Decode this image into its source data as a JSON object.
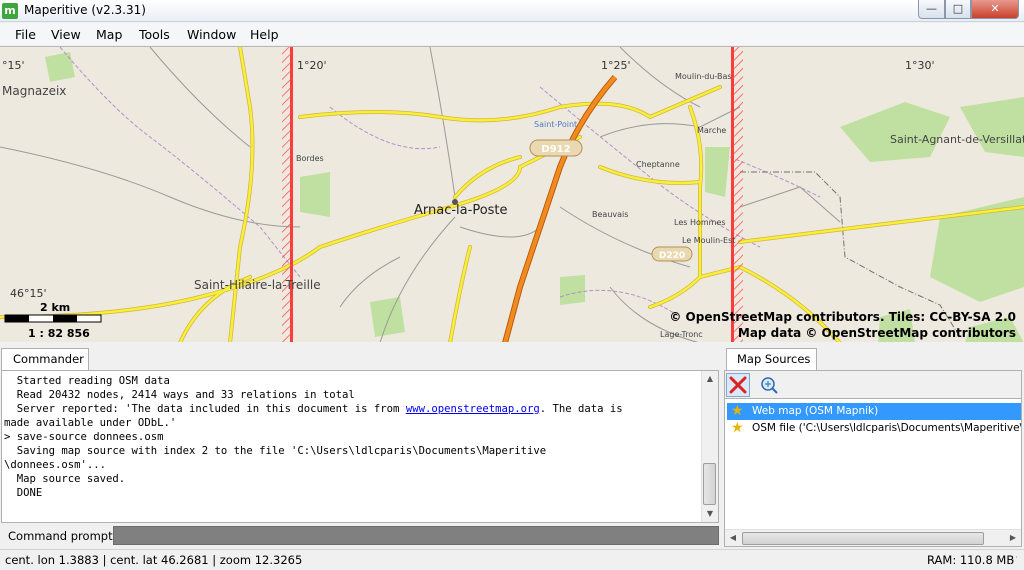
{
  "window": {
    "title": "Maperitive (v2.3.31)",
    "app_icon_letter": "m",
    "controls": {
      "minimize": "—",
      "maximize": "□",
      "close": "✕"
    }
  },
  "menu": [
    "File",
    "View",
    "Map",
    "Tools",
    "Window",
    "Help"
  ],
  "map": {
    "coords_top": [
      "°15'",
      "1°20'",
      "1°25'",
      "1°30'"
    ],
    "coord_left": "46°15'",
    "places": {
      "magnazeix": "Magnazeix",
      "arnac": "Arnac-la-Poste",
      "saint_hilaire": "Saint-Hilaire-la-Treille",
      "saint_agnant": "Saint-Agnant-de-Versillat",
      "bordes": "Bordes",
      "cheptanne": "Cheptanne",
      "beauvais": "Beauvais",
      "les_hommes": "Les Hommes",
      "le_moulin": "Le Moulin-Est",
      "lage": "Lage-Tronc",
      "moulin_bas": "Moulin-du-Bas",
      "saint_point": "Saint-Point",
      "marche": "Marche"
    },
    "road_labels": [
      "D912",
      "D220"
    ],
    "scale": {
      "distance": "2 km",
      "ratio": "1 : 82 856"
    },
    "attribution_line1": "© OpenStreetMap contributors. Tiles: CC-BY-SA 2.0",
    "attribution_line2": "Map data © OpenStreetMap contributors"
  },
  "commander": {
    "tab_label": "Commander",
    "lines": [
      "  Started reading OSM data",
      "  Read 20432 nodes, 2414 ways and 33 relations in total",
      "  Server reported: 'The data included in this document is from ",
      "made available under ODbL.'",
      "> save-source donnees.osm",
      "  Saving map source with index 2 to the file 'C:\\Users\\ldlcparis\\Documents\\Maperitive",
      "\\donnees.osm'...",
      "  Map source saved.",
      "  DONE"
    ],
    "link_text": "www.openstreetmap.org",
    "link_suffix": ". The data is",
    "prompt_label": "Command prompt:",
    "prompt_value": ""
  },
  "sources": {
    "tab_label": "Map Sources",
    "items": [
      {
        "label": "Web map (OSM Mapnik)",
        "selected": true
      },
      {
        "label": "OSM file ('C:\\Users\\ldlcparis\\Documents\\Maperitive\\donnees.osm')",
        "selected": false
      }
    ]
  },
  "status": {
    "left": "cent. lon 1.3883 | cent. lat 46.2681 | zoom 12.3265",
    "right": "RAM: 110.8 MB"
  },
  "colors": {
    "map_bg": "#eee9df",
    "road_yellow": "#f7f03a",
    "road_orange": "#f08b1d",
    "forest": "#b9dd99",
    "hatch": "#ff3b3b",
    "boundary": "#b38fc8",
    "selection": "#3399ff"
  }
}
